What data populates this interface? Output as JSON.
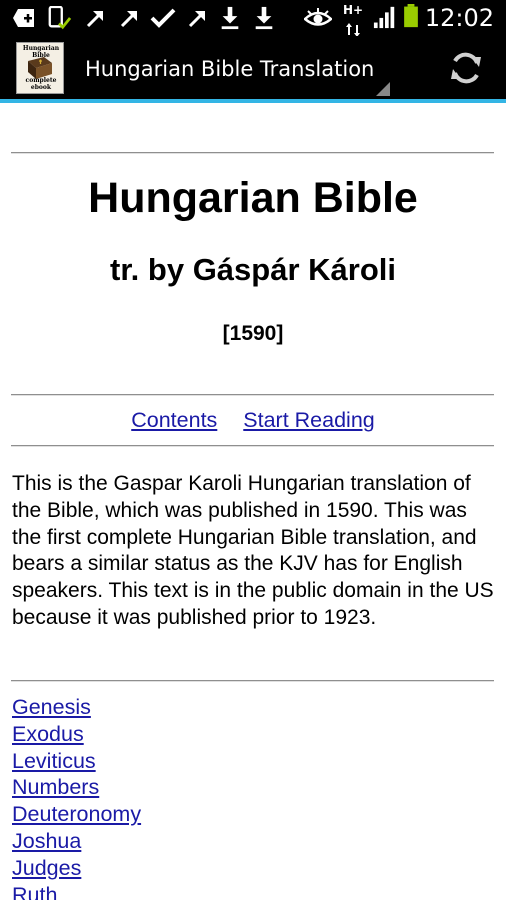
{
  "status_bar": {
    "time": "12:02",
    "icons": [
      "add-box-icon",
      "phone-check-icon",
      "missed-call-icon",
      "missed-call-icon",
      "check-icon",
      "missed-call-icon",
      "download-icon",
      "download-icon",
      "eye-icon",
      "hspa-plus-icon",
      "signal-bars-icon",
      "battery-icon"
    ],
    "network_label": "H+"
  },
  "action_bar": {
    "title": "Hungarian Bible Translation",
    "app_icon_text_top": "Hungarian Bible",
    "app_icon_text_bottom": "complete ebook",
    "refresh_icon": "refresh-icon",
    "accent_color": "#33b5e5"
  },
  "page": {
    "title": "Hungarian Bible",
    "subtitle": "tr. by Gáspár Károli",
    "year": "[1590]",
    "nav": {
      "contents": "Contents",
      "start_reading": "Start Reading"
    },
    "intro": "This is the Gaspar Karoli Hungarian translation of the Bible, which was published in 1590. This was the first complete Hungarian Bible translation, and bears a similar status as the KJV has for English speakers. This text is in the public domain in the US because it was published prior to 1923.",
    "books": [
      "Genesis",
      "Exodus",
      "Leviticus",
      "Numbers",
      "Deuteronomy",
      "Joshua",
      "Judges",
      "Ruth"
    ],
    "link_color": "#1a1aa6"
  }
}
